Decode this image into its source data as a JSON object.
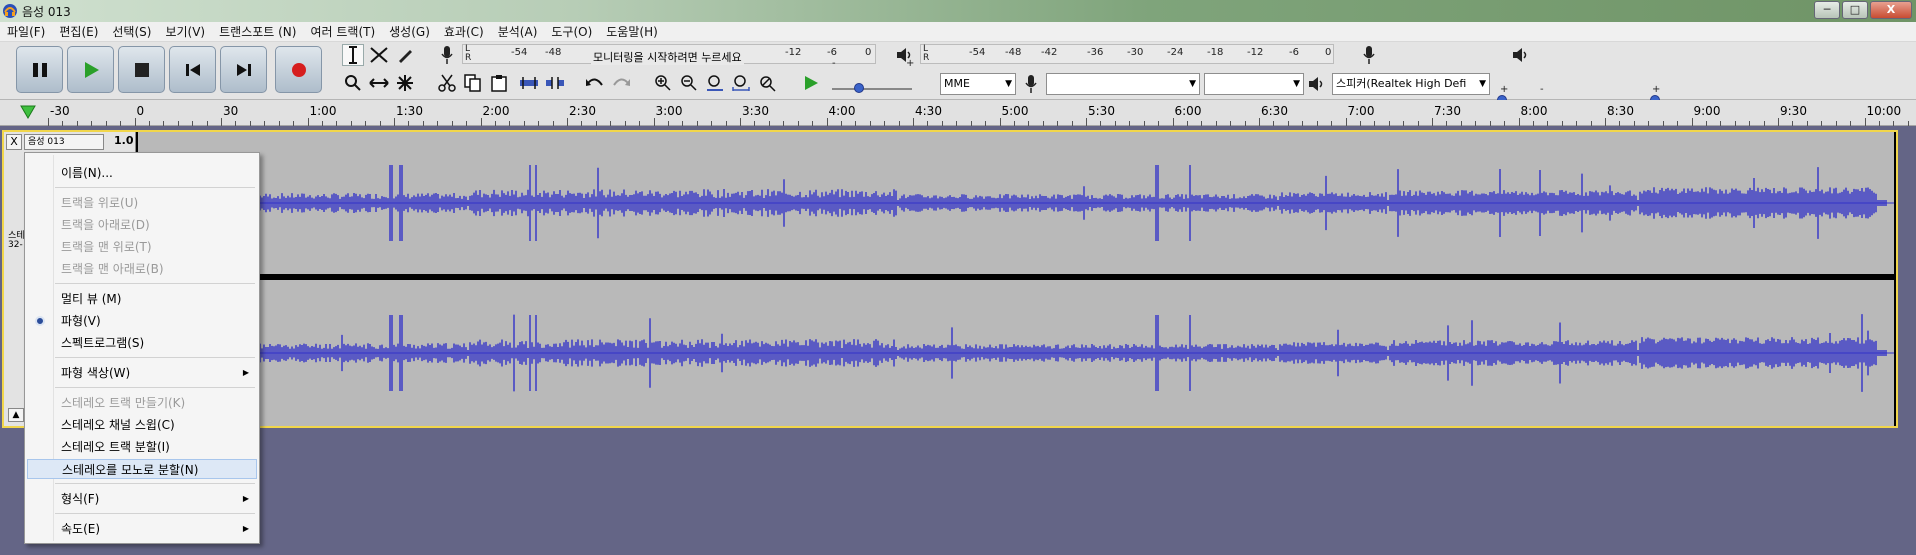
{
  "window": {
    "title": "음성 013",
    "controls": [
      "─",
      "□",
      "X"
    ]
  },
  "menubar": [
    "파일(F)",
    "편집(E)",
    "선택(S)",
    "보기(V)",
    "트랜스포트 (N)",
    "여러 트랙(T)",
    "생성(G)",
    "효과(C)",
    "분석(A)",
    "도구(O)",
    "도움말(H)"
  ],
  "meters": {
    "record_scale": [
      "-54",
      "-48",
      "-12",
      "-6",
      "0"
    ],
    "record_message": "모니터링을 시작하려면 누르세요",
    "play_scale": [
      "-54",
      "-48",
      "-42",
      "-36",
      "-30",
      "-24",
      "-18",
      "-12",
      "-6",
      "0"
    ],
    "lr": [
      "L",
      "R"
    ]
  },
  "sliders": {
    "minus": "-",
    "plus": "+"
  },
  "devices": {
    "host": "MME",
    "record_device": "",
    "record_channels": "",
    "playback_device": "스피커(Realtek High Defi"
  },
  "timeline": {
    "labels": [
      "-30",
      "0",
      "30",
      "1:00",
      "1:30",
      "2:00",
      "2:30",
      "3:00",
      "3:30",
      "4:00",
      "4:30",
      "5:00",
      "5:30",
      "6:00",
      "6:30",
      "7:00",
      "7:30",
      "8:00",
      "8:30",
      "9:00",
      "9:30",
      "10:00"
    ]
  },
  "track": {
    "close": "X",
    "name": "음성 013",
    "scale_top": "1.0",
    "side_labels": [
      "스테",
      "32-"
    ],
    "collapse": "▲"
  },
  "context_menu": {
    "items": [
      {
        "label": "이름(N)...",
        "disabled": false
      },
      {
        "label": "트랙을 위로(U)",
        "disabled": true
      },
      {
        "label": "트랙을 아래로(D)",
        "disabled": true
      },
      {
        "label": "트랙을 맨 위로(T)",
        "disabled": true
      },
      {
        "label": "트랙을 맨 아래로(B)",
        "disabled": true
      },
      {
        "label": "멀티 뷰 (M)",
        "disabled": false
      },
      {
        "label": "파형(V)",
        "disabled": false,
        "checked": true
      },
      {
        "label": "스펙트로그램(S)",
        "disabled": false
      },
      {
        "label": "파형 색상(W)",
        "disabled": false,
        "submenu": true
      },
      {
        "label": "스테레오 트랙 만들기(K)",
        "disabled": true
      },
      {
        "label": "스테레오 채널 스윕(C)",
        "disabled": false
      },
      {
        "label": "스테레오 트랙 분할(I)",
        "disabled": false
      },
      {
        "label": "스테레오를 모노로 분할(N)",
        "disabled": false,
        "hover": true
      },
      {
        "label": "형식(F)",
        "disabled": false,
        "submenu": true
      },
      {
        "label": "속도(E)",
        "disabled": false,
        "submenu": true
      }
    ]
  },
  "colors": {
    "wave": "#3232c8",
    "track_bg": "#b9b9b9",
    "selection_border": "#f1d64b",
    "workspace": "#646586"
  }
}
